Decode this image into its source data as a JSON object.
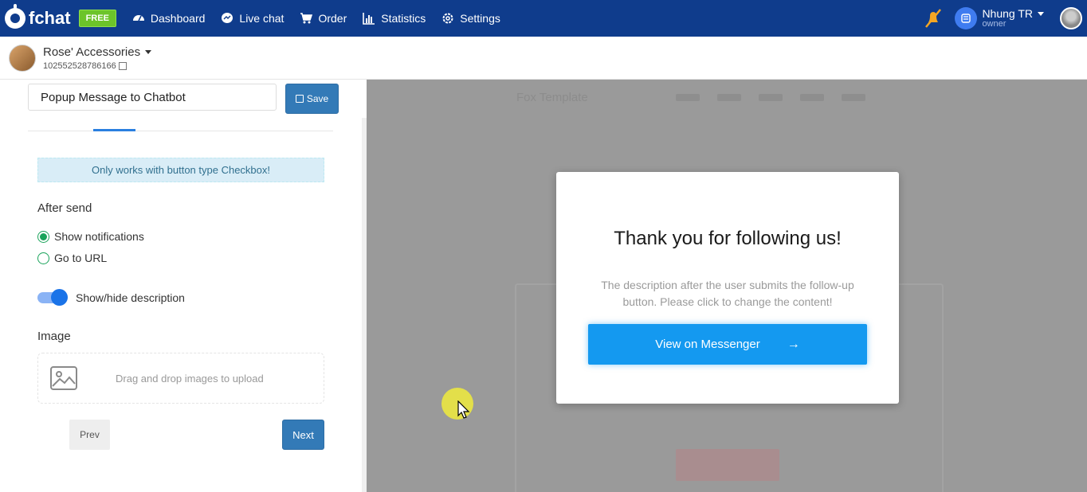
{
  "app": {
    "brand": "fchat",
    "plan_badge": "FREE",
    "nav": [
      {
        "label": "Dashboard",
        "icon": "dashboard-icon"
      },
      {
        "label": "Live chat",
        "icon": "messenger-icon"
      },
      {
        "label": "Order",
        "icon": "cart-icon"
      },
      {
        "label": "Statistics",
        "icon": "bar-chart-icon"
      },
      {
        "label": "Settings",
        "icon": "gear-icon"
      }
    ],
    "user": {
      "name": "Nhung TR",
      "role": "owner"
    },
    "colors": {
      "nav_bg": "#0f3c8c",
      "primary": "#337ab7",
      "messenger": "#1499f0",
      "success": "#19a35a"
    }
  },
  "page": {
    "name": "Rose' Accessories",
    "id": "102552528786166"
  },
  "editor": {
    "title_value": "Popup Message to Chatbot",
    "save_label": "Save",
    "alert": "Only works with button type Checkbox!",
    "after_send": {
      "title": "After send",
      "options": [
        {
          "label": "Show notifications",
          "checked": true
        },
        {
          "label": "Go to URL",
          "checked": false
        }
      ]
    },
    "toggle": {
      "label": "Show/hide description",
      "on": true
    },
    "image": {
      "title": "Image",
      "dropzone": "Drag and drop images to upload"
    },
    "prev_label": "Prev",
    "next_label": "Next"
  },
  "preview": {
    "background_brand": "Fox Template",
    "modal": {
      "title": "Thank you for following us!",
      "description": "The description after the user submits the follow-up button. Please click to change the content!",
      "button_label": "View on Messenger",
      "button_arrow": "→"
    }
  }
}
